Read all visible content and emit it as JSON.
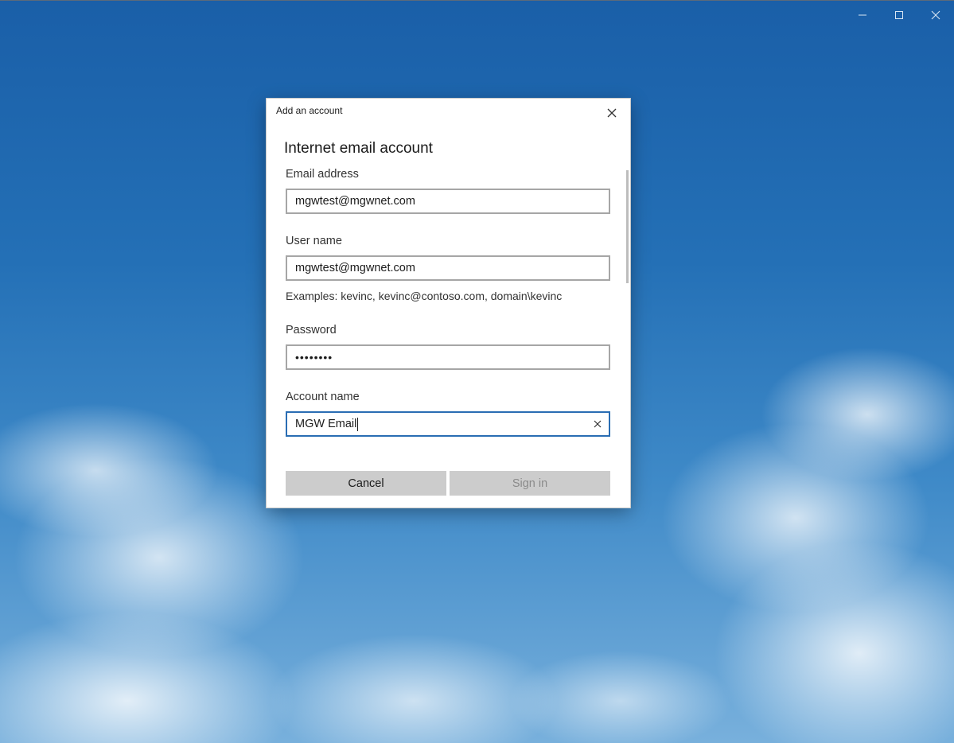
{
  "window": {
    "controls": {
      "minimize_icon": "minimize-icon",
      "maximize_icon": "maximize-icon",
      "close_icon": "close-icon"
    }
  },
  "dialog": {
    "title": "Add an account",
    "heading": "Internet email account",
    "fields": {
      "email": {
        "label": "Email address",
        "value": "mgwtest@mgwnet.com"
      },
      "username": {
        "label": "User name",
        "value": "mgwtest@mgwnet.com",
        "hint": "Examples: kevinc, kevinc@contoso.com, domain\\kevinc"
      },
      "password": {
        "label": "Password",
        "value": "••••••••"
      },
      "account_name": {
        "label": "Account name",
        "value": "MGW Email"
      }
    },
    "buttons": {
      "cancel": "Cancel",
      "sign_in": "Sign in"
    }
  },
  "colors": {
    "accent": "#2a6db3",
    "button_bg": "#cccccc",
    "disabled_text": "#8a8a8a"
  }
}
